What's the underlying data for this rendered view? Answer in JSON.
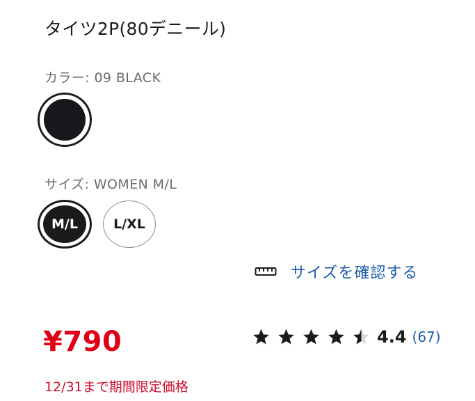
{
  "product": {
    "title": "タイツ2P(80デニール)"
  },
  "color": {
    "label": "カラー: 09 BLACK",
    "swatch_color": "#17181d"
  },
  "size": {
    "label": "サイズ: WOMEN M/L",
    "options": [
      {
        "label": "M/L",
        "selected": true
      },
      {
        "label": "L/XL",
        "selected": false
      }
    ],
    "guide_link": "サイズを確認する",
    "guide_icon": "ruler-icon"
  },
  "price": {
    "value": "¥790",
    "promo": "12/31まで期間限定価格"
  },
  "rating": {
    "stars": 4.5,
    "score": "4.4",
    "count": "(67)"
  },
  "colors": {
    "price_red": "#e00016",
    "link_blue": "#1f5ea8",
    "text_dark": "#1b1b1b",
    "label_gray": "#6c6c6c"
  }
}
